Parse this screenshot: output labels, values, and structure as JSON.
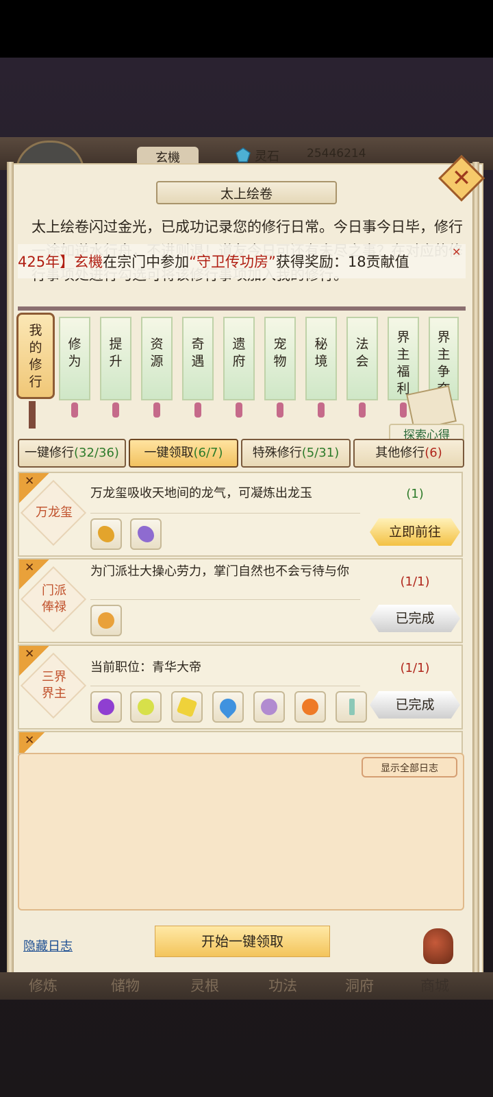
{
  "header": {
    "player_name": "玄機",
    "currency_label": "灵石",
    "currency_value": "25446214"
  },
  "panel": {
    "title": "太上绘卷",
    "intro": "太上绘卷闪过金光，已成功记录您的修行日常。今日事今日毕，修行一途如逆水行舟，不进则退！道友今日可还有未尽之事？在对应的修行事项处进行勾选可将该修行事项加入我的修行。",
    "marquee": {
      "year": "425年】",
      "name": "玄機",
      "text1": "在宗门中参加",
      "quote": "“守卫传功房”",
      "text2": "获得奖励：18贡献值"
    }
  },
  "scrolls": {
    "main": "我的修行",
    "items": [
      "修为",
      "提升",
      "资源",
      "奇遇",
      "遗府",
      "宠物",
      "秘境",
      "法会",
      "界主福利",
      "界主争夺"
    ],
    "explore": "探索心得"
  },
  "tabs": [
    {
      "label": "一键修行",
      "count": "(32/36)"
    },
    {
      "label": "一键领取",
      "count": "(6/7)"
    },
    {
      "label": "特殊修行",
      "count": "(5/31)"
    },
    {
      "label": "其他修行",
      "count": "(6)"
    }
  ],
  "tasks": [
    {
      "name_line1": "万龙玺",
      "name_line2": "",
      "desc": "万龙玺吸收天地间的龙气，可凝炼出龙玉",
      "progress": "(1)",
      "button": "立即前往",
      "items": [
        "dragon-gold-icon",
        "dragon-purple-icon"
      ]
    },
    {
      "name_line1": "门派",
      "name_line2": "俸禄",
      "desc": "为门派壮大操心劳力，掌门自然也不会亏待与你",
      "progress": "(1/1)",
      "button": "已完成",
      "items": [
        "money-bag-icon"
      ]
    },
    {
      "name_line1": "三界",
      "name_line2": "界主",
      "desc": "当前职位：青华大帝",
      "progress": "(1/1)",
      "button": "已完成",
      "items": [
        "purple-orb-icon",
        "yellow-orb-icon",
        "yellow-crystal-icon",
        "blue-crystal-icon",
        "lavender-herb-icon",
        "orange-flower-icon",
        "spirit-sword-icon"
      ]
    }
  ],
  "log": {
    "show_all": "显示全部日志",
    "hide": "隐藏日志",
    "start": "开始一键领取"
  },
  "bottom_nav": [
    "修炼",
    "储物",
    "灵根",
    "功法",
    "洞府",
    "商城"
  ]
}
